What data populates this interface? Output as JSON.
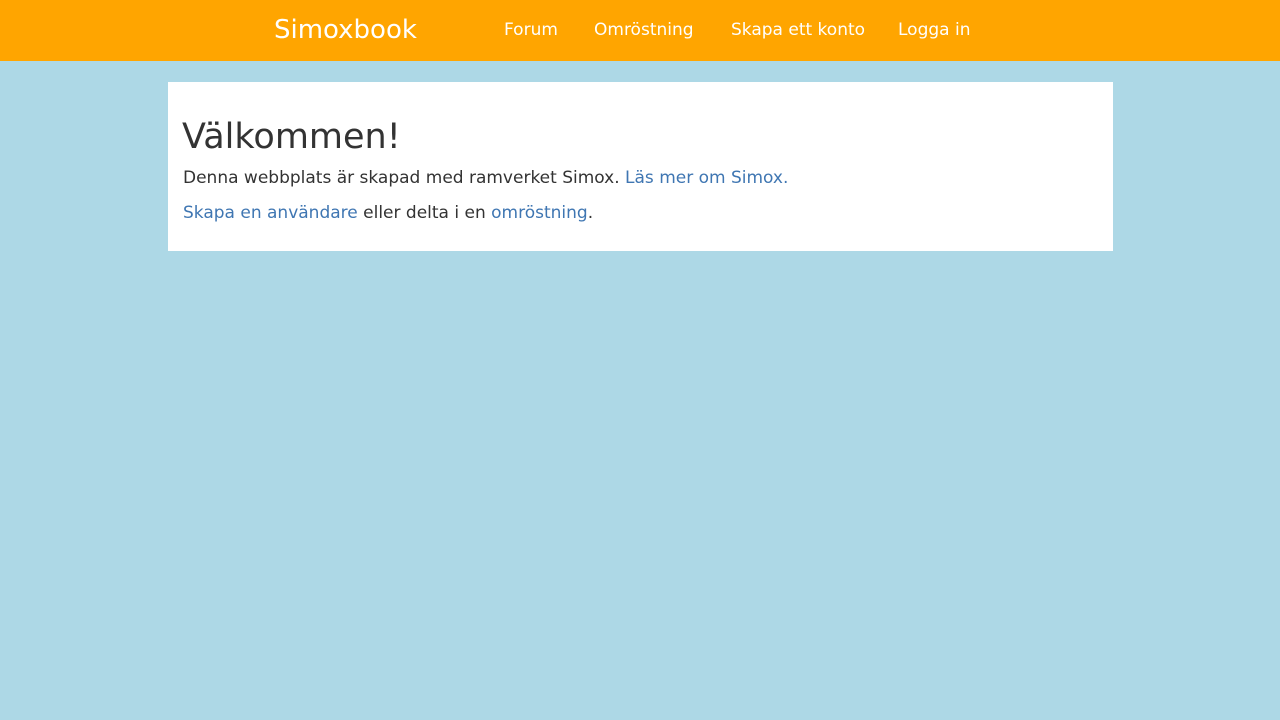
{
  "header": {
    "brand": "Simoxbook",
    "nav": {
      "forum": "Forum",
      "vote": "Omröstning",
      "create_account": "Skapa ett konto",
      "login": "Logga in"
    }
  },
  "main": {
    "title": "Välkommen!",
    "intro_text": "Denna webbplats är skapad med ramverket Simox.",
    "read_more_link": "Läs mer om Simox.",
    "create_user_link": "Skapa en användare",
    "middle_text": "eller delta i en",
    "vote_link": "omröstning",
    "end_period": "."
  },
  "colors": {
    "header": "#ffa500",
    "background": "#add8e6",
    "panel": "#ffffff",
    "text": "#333333",
    "link": "#3f76b2"
  }
}
